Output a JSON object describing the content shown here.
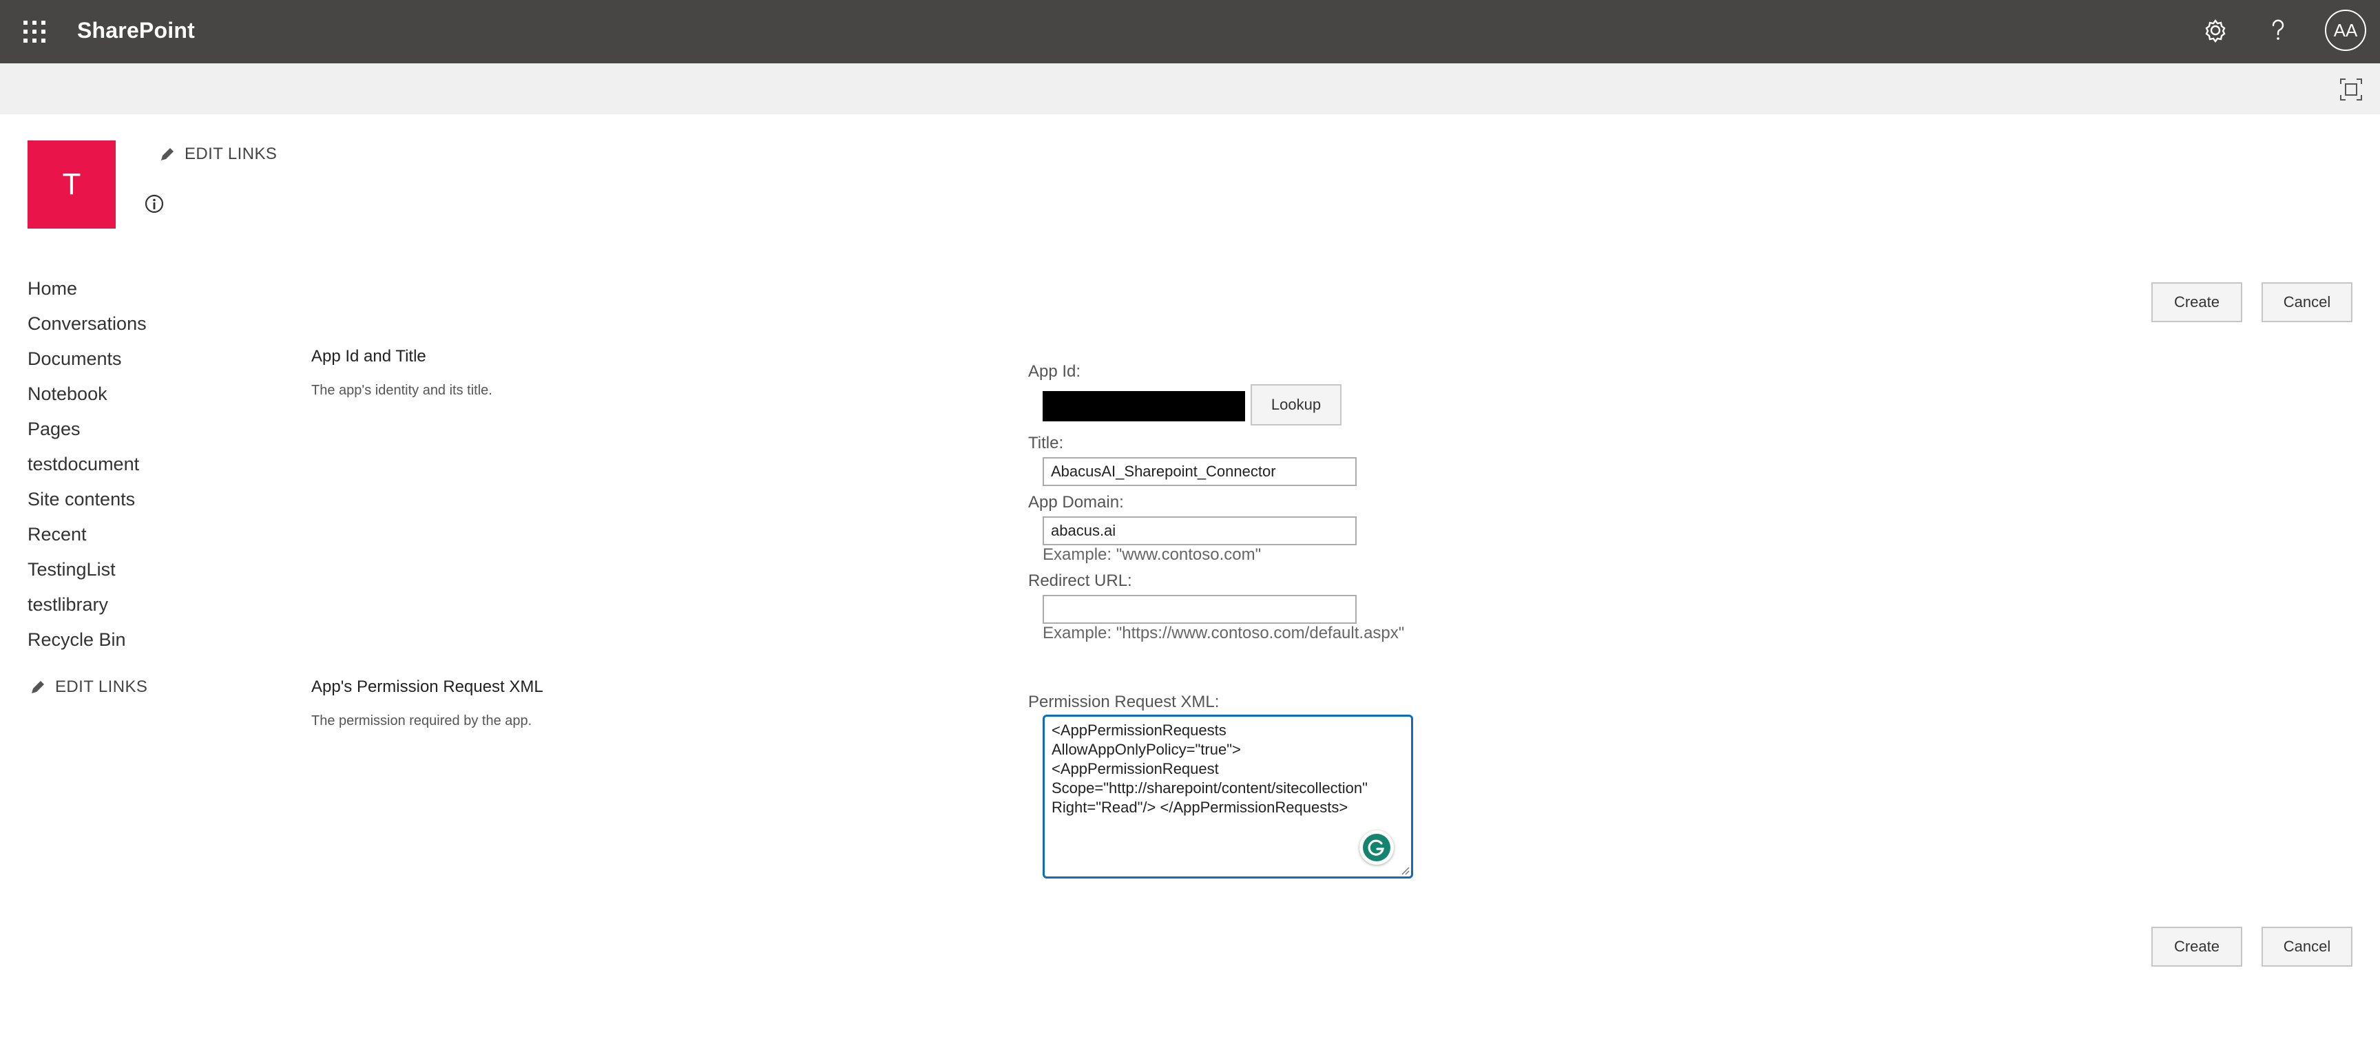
{
  "suite_bar": {
    "app_name": "SharePoint",
    "avatar_initials": "AA",
    "background": "#474645",
    "icons": [
      "app-launcher-icon",
      "gear-icon",
      "help-icon"
    ]
  },
  "ribbon": {
    "icons": [
      "focus-mode-icon"
    ]
  },
  "site": {
    "logo_letter": "T",
    "logo_color": "#e8144a",
    "edit_links_label": "EDIT LINKS"
  },
  "nav": {
    "items": [
      "Home",
      "Conversations",
      "Documents",
      "Notebook",
      "Pages",
      "testdocument",
      "Site contents",
      "Recent",
      "TestingList",
      "testlibrary",
      "Recycle Bin"
    ],
    "edit_links_label": "EDIT LINKS"
  },
  "actions": {
    "create_label": "Create",
    "cancel_label": "Cancel"
  },
  "section_identity": {
    "title": "App Id and Title",
    "description": "The app's identity and its title."
  },
  "section_permission": {
    "title": "App's Permission Request XML",
    "description": "The permission required by the app."
  },
  "form": {
    "app_id_label": "App Id:",
    "lookup_label": "Lookup",
    "title_label": "Title:",
    "title_value": "AbacusAI_Sharepoint_Connector",
    "app_domain_label": "App Domain:",
    "app_domain_value": "abacus.ai",
    "app_domain_example": "Example: \"www.contoso.com\"",
    "redirect_url_label": "Redirect URL:",
    "redirect_url_value": "",
    "redirect_url_example": "Example: \"https://www.contoso.com/default.aspx\"",
    "permission_xml_label": "Permission Request XML:",
    "permission_xml_value": "<AppPermissionRequests AllowAppOnlyPolicy=\"true\"> <AppPermissionRequest Scope=\"http://sharepoint/content/sitecollection\" Right=\"Read\"/> </AppPermissionRequests>",
    "accent_color": "#0f6cbd",
    "grammarly_color": "#15846f"
  }
}
